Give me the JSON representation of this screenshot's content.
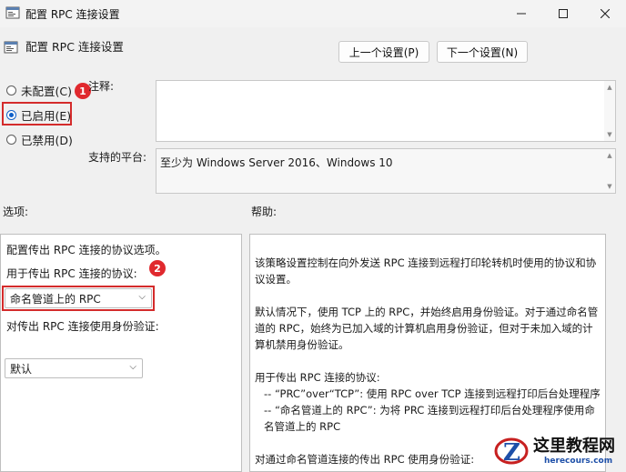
{
  "window": {
    "title": "配置 RPC 连接设置"
  },
  "header": {
    "title": "配置 RPC 连接设置",
    "prev_label": "上一个设置(P)",
    "next_label": "下一个设置(N)"
  },
  "state": {
    "options": [
      {
        "label": "未配置(C)",
        "checked": false
      },
      {
        "label": "已启用(E)",
        "checked": true
      },
      {
        "label": "已禁用(D)",
        "checked": false
      }
    ]
  },
  "annotations": {
    "badge1": "1",
    "badge2": "2"
  },
  "comment": {
    "label": "注释:",
    "value": ""
  },
  "platform": {
    "label": "支持的平台:",
    "value": "至少为 Windows Server 2016、Windows 10"
  },
  "options_section": {
    "label": "选项:",
    "line1": "配置传出 RPC 连接的协议选项。",
    "protocol_label": "用于传出 RPC 连接的协议:",
    "protocol_value": "命名管道上的 RPC",
    "auth_label": "对传出 RPC 连接使用身份验证:",
    "auth_value": "默认"
  },
  "help_section": {
    "label": "帮助:",
    "p1": "该策略设置控制在向外发送 RPC 连接到远程打印轮转机时使用的协议和协议设置。",
    "p2": "默认情况下，使用 TCP 上的 RPC，并始终启用身份验证。对于通过命名管道的 RPC，始终为已加入域的计算机启用身份验证，但对于未加入域的计算机禁用身份验证。",
    "p3a": "用于传出 RPC 连接的协议:",
    "p3b": "-- “PRC”over“TCP”: 使用 RPC over TCP 连接到远程打印后台处理程序",
    "p3c": "-- “命名管道上的 RPC”: 为将 PRC 连接到远程打印后台处理程序使用命名管道上的 RPC",
    "p4": "对通过命名管道连接的传出 RPC 使用身份验证:"
  },
  "watermark": {
    "text": "这里教程网",
    "url": "herecours.com"
  }
}
